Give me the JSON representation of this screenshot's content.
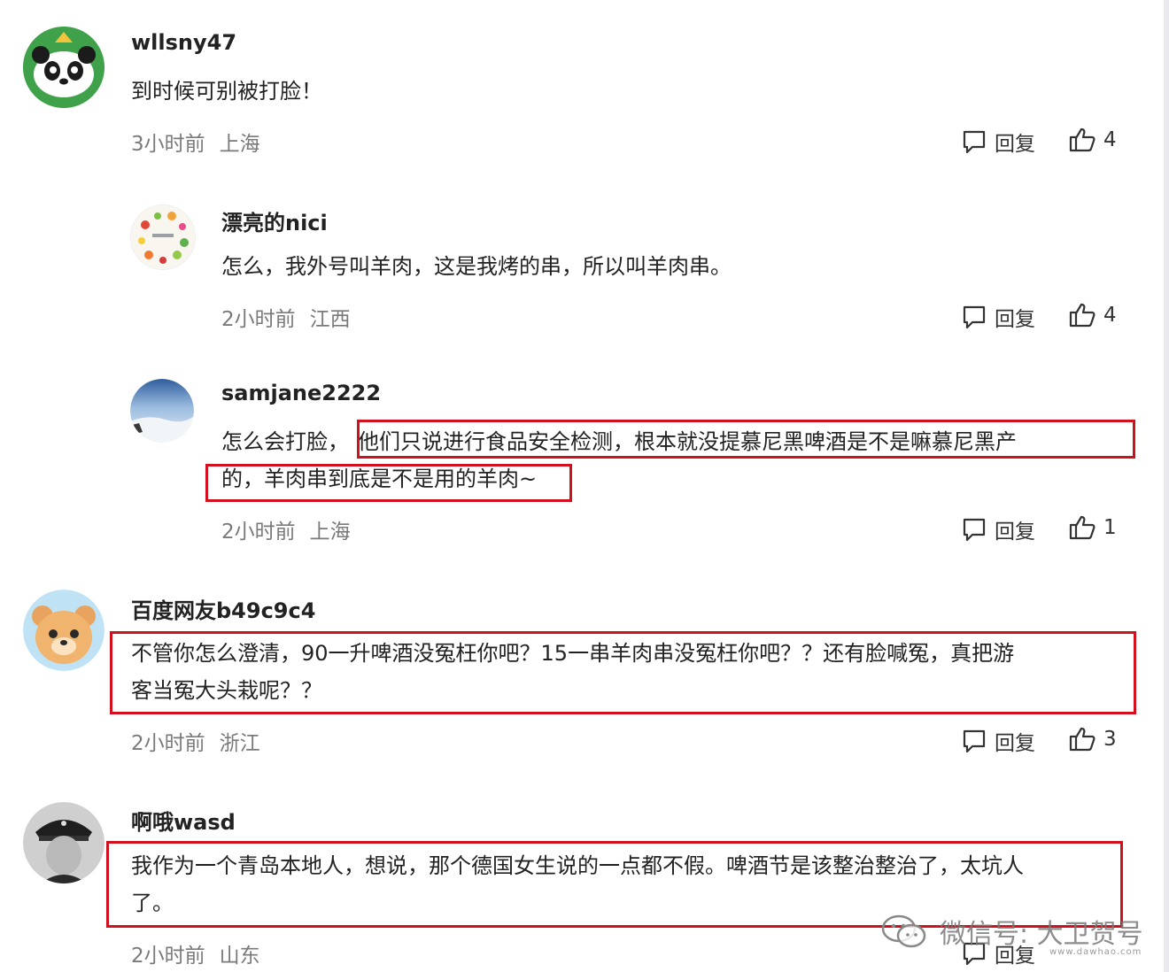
{
  "comments": [
    {
      "username": "wllsny47",
      "text": "到时候可别被打脸！",
      "time": "3小时前",
      "location": "上海",
      "reply_label": "回复",
      "likes": "4",
      "avatar": "panda-avatar"
    },
    {
      "username": "漂亮的nici",
      "text": "怎么，我外号叫羊肉，这是我烤的串，所以叫羊肉串。",
      "time": "2小时前",
      "location": "江西",
      "reply_label": "回复",
      "likes": "4",
      "avatar": "fruit-plate-avatar"
    },
    {
      "username": "samjane2222",
      "text_prefix": "怎么会打脸，",
      "text_line1_highlight": "他们只说进行食品安全检测，根本就没提慕尼黑啤酒是不是嘛慕尼黑产",
      "text_line2_highlight": "的，羊肉串到底是不是用的羊肉~",
      "time": "2小时前",
      "location": "上海",
      "reply_label": "回复",
      "likes": "1",
      "avatar": "sky-avatar"
    },
    {
      "username": "百度网友b49c9c4",
      "text_line1": "不管你怎么澄清，90一升啤酒没冤枉你吧？15一串羊肉串没冤枉你吧？？还有脸喊冤，真把游",
      "text_line2": "客当冤大头栽呢？？",
      "time": "2小时前",
      "location": "浙江",
      "reply_label": "回复",
      "likes": "3",
      "avatar": "bear-avatar"
    },
    {
      "username": "啊哦wasd",
      "text_line1": "我作为一个青岛本地人，想说，那个德国女生说的一点都不假。啤酒节是该整治整治了，太坑人",
      "text_line2": "了。",
      "time": "2小时前",
      "location": "山东",
      "reply_label": "回复",
      "avatar": "officer-avatar"
    }
  ],
  "watermark": {
    "text": "微信号: 大卫贺号",
    "sub": "www.dawhao.com"
  },
  "colors": {
    "highlight_box": "#d0101c",
    "meta_text": "#7a7a7a"
  }
}
